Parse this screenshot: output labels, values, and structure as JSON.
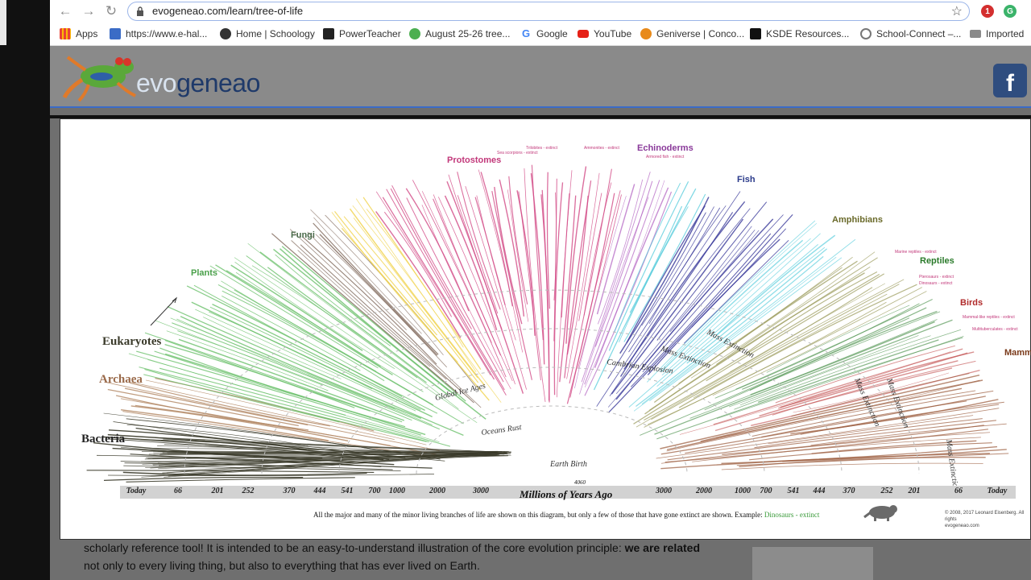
{
  "browser": {
    "url": "evogeneao.com/learn/tree-of-life",
    "bookmarks": [
      {
        "label": "Apps",
        "icon": "apps-grid-icon",
        "color": "#4285f4"
      },
      {
        "label": "https://www.e-hal...",
        "icon": "ehall-icon",
        "color": "#3b6cc6"
      },
      {
        "label": "Home | Schoology",
        "icon": "schoology-icon",
        "color": "#333333"
      },
      {
        "label": "PowerTeacher",
        "icon": "powerteacher-icon",
        "color": "#222222"
      },
      {
        "label": "August 25-26 tree...",
        "icon": "evernote-icon",
        "color": "#4caf50"
      },
      {
        "label": "Google",
        "icon": "google-icon",
        "color": "#4285f4"
      },
      {
        "label": "YouTube",
        "icon": "youtube-icon",
        "color": "#e62117"
      },
      {
        "label": "Geniverse | Conco...",
        "icon": "geniverse-icon",
        "color": "#e88a1a"
      },
      {
        "label": "KSDE Resources...",
        "icon": "blackboard-icon",
        "color": "#111111"
      },
      {
        "label": "School-Connect –...",
        "icon": "school-connect-icon",
        "color": "#777777"
      },
      {
        "label": "Imported",
        "icon": "folder-icon",
        "color": "#777777"
      }
    ]
  },
  "site": {
    "logo_text_light": "evo",
    "logo_text_dark": "geneao",
    "facebook_glyph": "f",
    "body_line1": "scholarly reference tool! It is intended to be an easy-to-understand illustration of the core evolution principle: ",
    "body_bold1": "we are related",
    "body_line2": "not only to every living thing, but also to everything that has ever lived on Earth."
  },
  "tree": {
    "groups": {
      "protostomes": "Protostomes",
      "echinoderms": "Echinoderms",
      "fish": "Fish",
      "amphibians": "Amphibians",
      "reptiles": "Reptiles",
      "birds": "Birds",
      "mammals": "Mamm",
      "fungi": "Fungi",
      "plants": "Plants",
      "eukaryotes": "Eukaryotes",
      "archaea": "Archaea",
      "bacteria": "Bacteria"
    },
    "events": {
      "global_ice_ages": "Global Ice Ages",
      "cambrian_explosion": "Cambrian Explosion",
      "mass_extinction": "Mass Extinction",
      "oceans_rust": "Oceans Rust",
      "earth_birth": "Earth Birth"
    },
    "extinct_notes": {
      "trilobites": "Trilobites - extinct",
      "sea_scorpions": "Sea scorpions - extinct",
      "ammonites": "Ammonites - extinct",
      "armored_fish": "Armored fish - extinct",
      "marine_reptiles": "Marine reptiles - extinct",
      "pterosaurs": "Pterosaurs - extinct",
      "dinosaurs": "Dinosaurs - extinct",
      "mammal_like": "Mammal-like reptiles - extinct",
      "multituberculates": "Multituberculates - extinct"
    },
    "axis_ticks_left": [
      "Today",
      "66",
      "201",
      "252",
      "370",
      "444",
      "541",
      "700",
      "1000",
      "2000",
      "3000"
    ],
    "axis_ticks_right": [
      "3000",
      "2000",
      "1000",
      "700",
      "541",
      "444",
      "370",
      "252",
      "201",
      "66",
      "Today"
    ],
    "axis_center_value": "4060",
    "axis_title": "Millions of Years Ago",
    "caption": "All the major and many of the minor living branches of life are shown on this diagram, but only a few of those that have gone extinct are shown. Example: ",
    "caption_example": "Dinosaurs - extinct",
    "copyright_line1": "© 2008, 2017 Leonard Eisenberg. All rights",
    "copyright_line2": "evogeneao.com"
  },
  "colors": {
    "bacteria": "#3a3a2a",
    "archaea": "#b08560",
    "plants": "#6cc06c",
    "fungi": "#6b5040",
    "yellow": "#f0d24a",
    "protostomes": "#d24a86",
    "echinoderms": "#b060c0",
    "fish": "#3a3a9a",
    "cyan": "#48c8d8",
    "amphibians": "#9a9a5a",
    "reptiles": "#5a9a5a",
    "birds": "#c04a4a",
    "mammals": "#9a5a3a"
  }
}
